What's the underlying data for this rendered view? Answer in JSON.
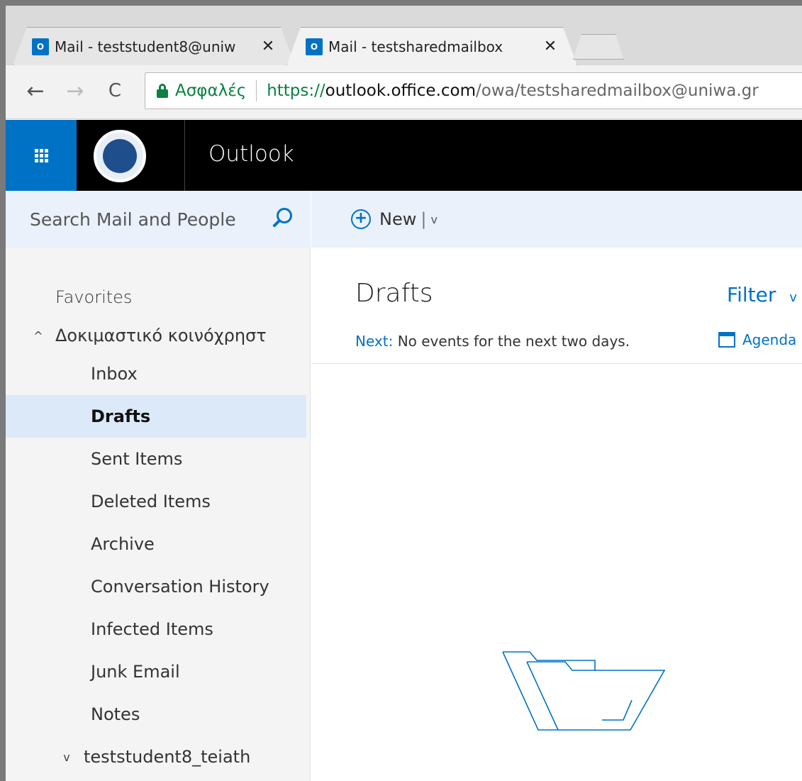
{
  "browser": {
    "tabs": [
      {
        "icon": "outlook-icon",
        "icon_text": "O",
        "title": "Mail - teststudent8@uniw",
        "close": "✕"
      },
      {
        "icon": "outlook-icon",
        "icon_text": "O",
        "title": "Mail - testsharedmailbox",
        "close": "✕"
      }
    ],
    "nav": {
      "back": "←",
      "forward": "→",
      "reload": "C"
    },
    "address": {
      "security_label": "Ασφαλές",
      "url_scheme": "https://",
      "url_host": "outlook.office.com",
      "url_path": "/owa/testsharedmailbox@uniwa.gr"
    }
  },
  "header": {
    "app_title": "Outlook"
  },
  "search": {
    "placeholder": "Search Mail and People"
  },
  "sidebar": {
    "favorites_label": "Favorites",
    "group_name": "Δοκιμαστικό κοινόχρηστ",
    "group_chevron": "^",
    "folders": [
      {
        "label": "Inbox"
      },
      {
        "label": "Drafts",
        "selected": true
      },
      {
        "label": "Sent Items"
      },
      {
        "label": "Deleted Items"
      },
      {
        "label": "Archive"
      },
      {
        "label": "Conversation History"
      },
      {
        "label": "Infected Items"
      },
      {
        "label": "Junk Email"
      },
      {
        "label": "Notes"
      }
    ],
    "second_group": "teststudent8_teiath",
    "second_group_chevron": "v"
  },
  "commands": {
    "new_label": "New",
    "separator": "|",
    "chevron": "v"
  },
  "main": {
    "folder_title": "Drafts",
    "filter_label": "Filter",
    "filter_chevron": "v",
    "next_label": "Next:",
    "next_text": " No events for the next two days.",
    "agenda_label": "Agenda"
  },
  "colors": {
    "accent": "#0072c6",
    "selected": "#dbe9f8",
    "secure": "#0b8043",
    "header": "#000000"
  }
}
